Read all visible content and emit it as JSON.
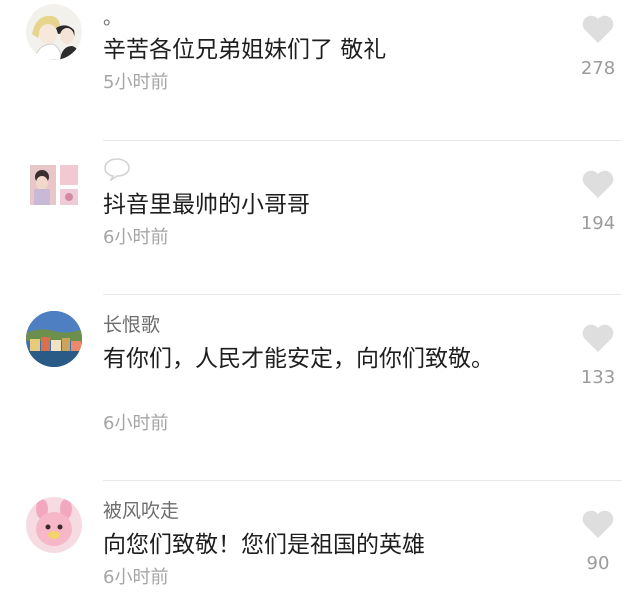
{
  "comments": [
    {
      "username": "。",
      "text": "辛苦各位兄弟姐妹们了 敬礼",
      "time": "5小时前",
      "likes": "278",
      "avatar_icon": "anime-couple-avatar"
    },
    {
      "username": "",
      "text": "抖音里最帅的小哥哥",
      "time": "6小时前",
      "likes": "194",
      "avatar_icon": "photo-collage-avatar"
    },
    {
      "username": "长恨歌",
      "text": "有你们，人民才能安定，向你们致敬。",
      "time": "6小时前",
      "likes": "133",
      "avatar_icon": "coastal-town-avatar"
    },
    {
      "username": "被风吹走",
      "text": "向您们致敬！您们是祖国的英雄",
      "time": "6小时前",
      "likes": "90",
      "avatar_icon": "pink-plush-avatar"
    }
  ],
  "colors": {
    "heart": "#dedede",
    "text": "#1e1e1e",
    "username": "#6d6d6d",
    "timestamp": "#a5a5a5",
    "divider": "#e9e9e9"
  }
}
